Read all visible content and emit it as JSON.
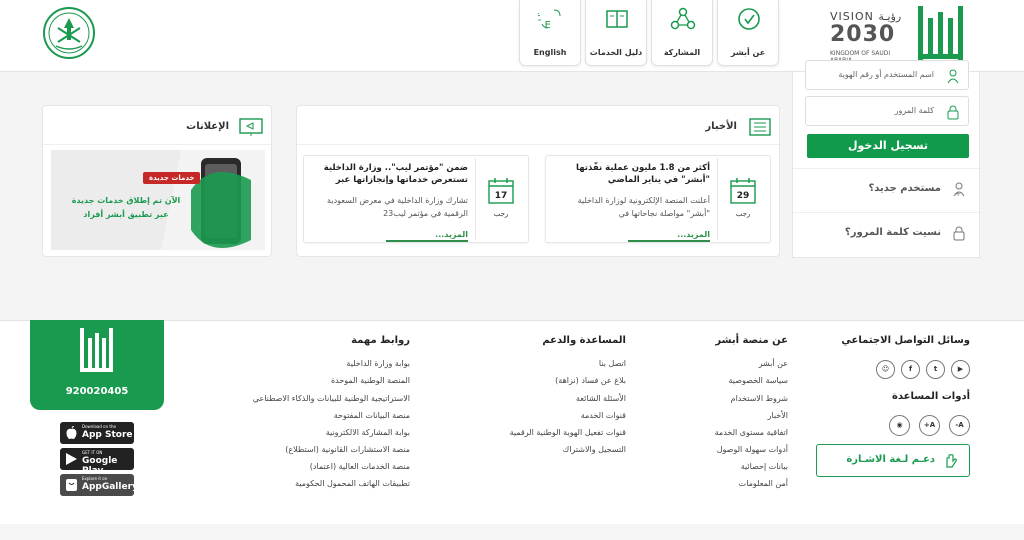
{
  "header": {
    "vision": {
      "line1": "VISION رؤيـة",
      "line2": "2030",
      "line3": "KINGDOM OF SAUDI ARABIA"
    },
    "nav": [
      {
        "label": "عن أبشر",
        "icon": "about-icon"
      },
      {
        "label": "المشاركة",
        "icon": "share-icon"
      },
      {
        "label": "دليل الخدمات",
        "icon": "guide-book-icon"
      },
      {
        "label": "English",
        "icon": "language-icon"
      }
    ]
  },
  "login": {
    "username_placeholder": "اسم المستخدم أو رقم الهوية",
    "password_placeholder": "كلمة المرور",
    "login_button": "تسجيل الدخول",
    "new_user": "مستخدم جديد؟",
    "forgot_password": "نسيت كلمة المرور؟"
  },
  "news": {
    "title": "الأخبار",
    "items": [
      {
        "day": "29",
        "month": "رجب",
        "title": "أكثر من 1.8 مليون عملية نفّذتها \"أبشر\" في يناير الماضي",
        "body": "أعلنت المنصة الإلكترونية لوزارة الداخلية \"أبشر\" مواصلة نجاحاتها في",
        "more": "المزيد..."
      },
      {
        "day": "17",
        "month": "رجب",
        "title": "ضمن \"مؤتمر ليب\".. وزارة الداخلية تستعرض خدماتها وإنجازاتها عبر",
        "body": "تشارك وزارة الداخلية في معرض السعودية الرقمية في مؤتمر ليب23",
        "more": "المزيد..."
      }
    ]
  },
  "ads": {
    "title": "الإعلانات",
    "badge": "خدمات جديدة",
    "text1": "الآن تم إطلاق خدمات جديدة",
    "text2": "عبر تطبيق أبشر أفراد"
  },
  "footer": {
    "social_title": "وسائل التواصل الاجتماعي",
    "social_icons": [
      "snapchat-icon",
      "facebook-icon",
      "twitter-icon",
      "youtube-icon"
    ],
    "tools_title": "أدوات المساعدة",
    "tools": [
      "A-",
      "A+",
      "eye-icon"
    ],
    "sign_language": "دعـم لـغة الاشـارة",
    "about_title": "عن منصة أبشر",
    "about_links": [
      "عن أبشر",
      "سياسة الخصوصية",
      "شروط الاستخدام",
      "الأخبار",
      "اتفاقية مستوى الخدمة",
      "أدوات سهولة الوصول",
      "بيانات إحصائية",
      "أمن المعلومات"
    ],
    "support_title": "المساعدة والدعم",
    "support_links": [
      "اتصل بنا",
      "بلاغ عن فساد (نزاهة)",
      "الأسئلة الشائعة",
      "قنوات الخدمة",
      "قنوات تفعيل الهوية الوطنية الرقمية",
      "التسجيل والاشتراك"
    ],
    "links_title": "روابط مهمة",
    "important_links": [
      "بوابة وزارة الداخلية",
      "المنصة الوطنية الموحدة",
      "الاستراتيجية الوطنية للبيانات والذكاء الاصطناعي",
      "منصة البيانات المفتوحة",
      "بوابة المشاركة الالكترونية",
      "منصة الاستشارات القانونية (استطلاع)",
      "منصة الخدمات العالية (اعتماد)",
      "تطبيقات الهاتف المحمول الحكومية"
    ],
    "phone": "920020405",
    "stores": [
      {
        "small": "Download on the",
        "name": "App Store"
      },
      {
        "small": "GET IT ON",
        "name": "Google Play"
      },
      {
        "small": "Explore it on",
        "name": "AppGallery"
      }
    ]
  },
  "colors": {
    "brand_green": "#1a9a4f",
    "text": "#333333"
  }
}
